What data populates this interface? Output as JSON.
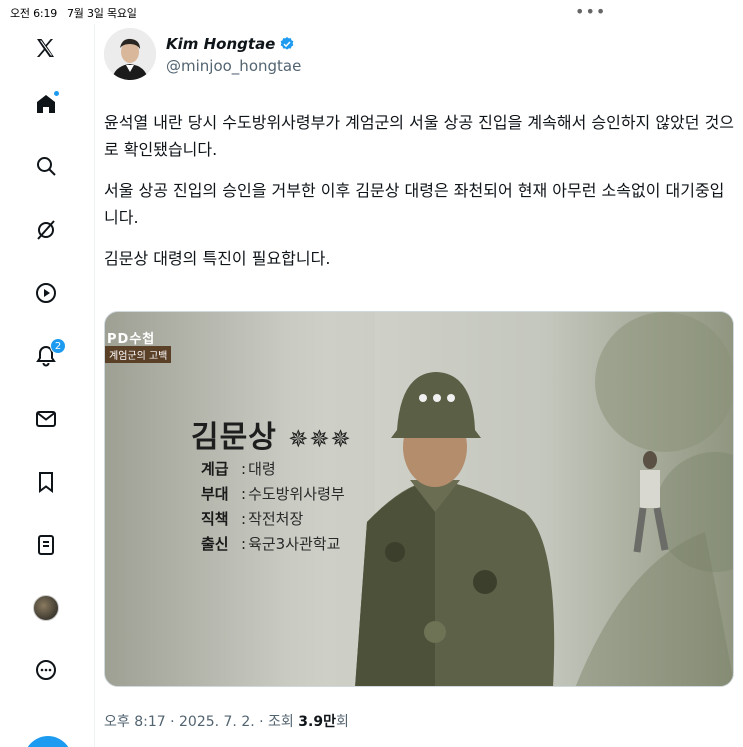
{
  "status_bar": {
    "time": "오전 6:19",
    "date": "7월 3일 목요일",
    "dots": "•••"
  },
  "sidebar": {
    "items": [
      {
        "icon": "x-logo-icon"
      },
      {
        "icon": "home-icon"
      },
      {
        "icon": "search-icon"
      },
      {
        "icon": "grok-icon"
      },
      {
        "icon": "video-icon"
      },
      {
        "icon": "notifications-icon",
        "badge": "2"
      },
      {
        "icon": "messages-icon"
      },
      {
        "icon": "bookmarks-icon"
      },
      {
        "icon": "lists-icon"
      },
      {
        "icon": "profile-avatar"
      },
      {
        "icon": "more-icon"
      }
    ]
  },
  "tweet": {
    "author_name": "Kim Hongtae",
    "handle": "@minjoo_hongtae",
    "paragraphs": [
      "윤석열 내란 당시 수도방위사령부가 계엄군의 서울 상공 진입을 계속해서 승인하지 않았던 것으로 확인됐습니다.",
      "서울 상공 진입의 승인을 거부한 이후 김문상 대령은 좌천되어 현재 아무런 소속없이 대기중입니다.",
      "김문상 대령의 특진이 필요합니다."
    ],
    "media": {
      "logo": "PD수첩",
      "tag": "계엄군의 고백",
      "caption_name": "김문상",
      "stars": "✵✵✵",
      "rows": [
        {
          "key": "계급",
          "value": "대령"
        },
        {
          "key": "부대",
          "value": "수도방위사령부"
        },
        {
          "key": "직책",
          "value": "작전처장"
        },
        {
          "key": "출신",
          "value": "육군3사관학교"
        }
      ]
    },
    "meta_time": "오후 8:17 · 2025. 7. 2. · 조회 ",
    "meta_views": "3.9만",
    "meta_suffix": "회"
  },
  "colors": {
    "accent": "#1d9bf0",
    "text": "#0f1419",
    "muted": "#536471"
  }
}
